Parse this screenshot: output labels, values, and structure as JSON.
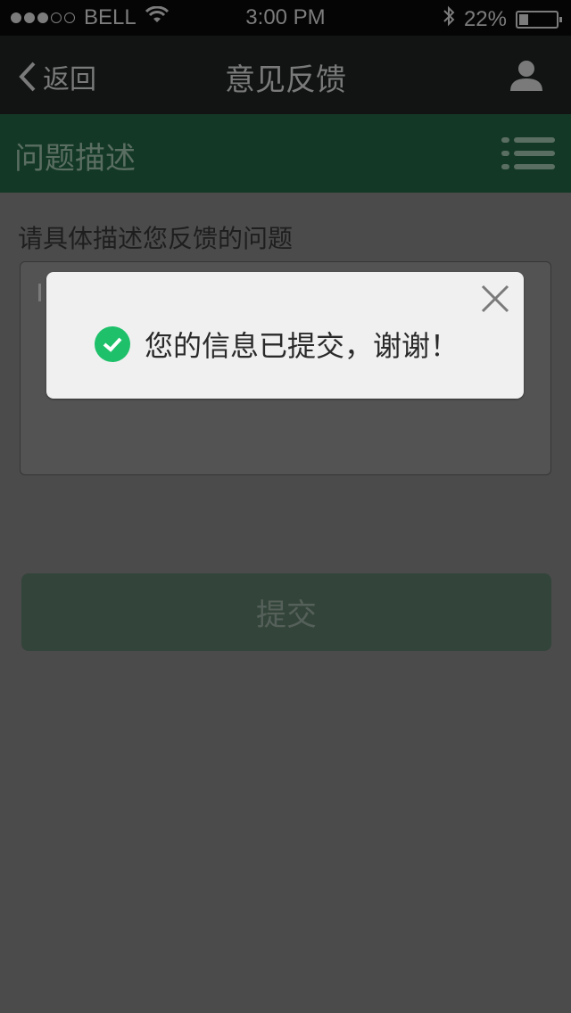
{
  "status_bar": {
    "carrier": "BELL",
    "time": "3:00 PM",
    "battery": "22%",
    "battery_level": 0.22,
    "signal_bars_filled": 3,
    "signal_bars_total": 5
  },
  "nav": {
    "back_label": "返回",
    "title": "意见反馈"
  },
  "section": {
    "title": "问题描述"
  },
  "form": {
    "prompt": "请具体描述您反馈的问题",
    "textarea_value": "",
    "submit_label": "提交"
  },
  "toast": {
    "message": "您的信息已提交，谢谢！"
  },
  "colors": {
    "accent": "#1ec06a",
    "section_bg": "#143826",
    "overlay": "#4b4b4b"
  }
}
